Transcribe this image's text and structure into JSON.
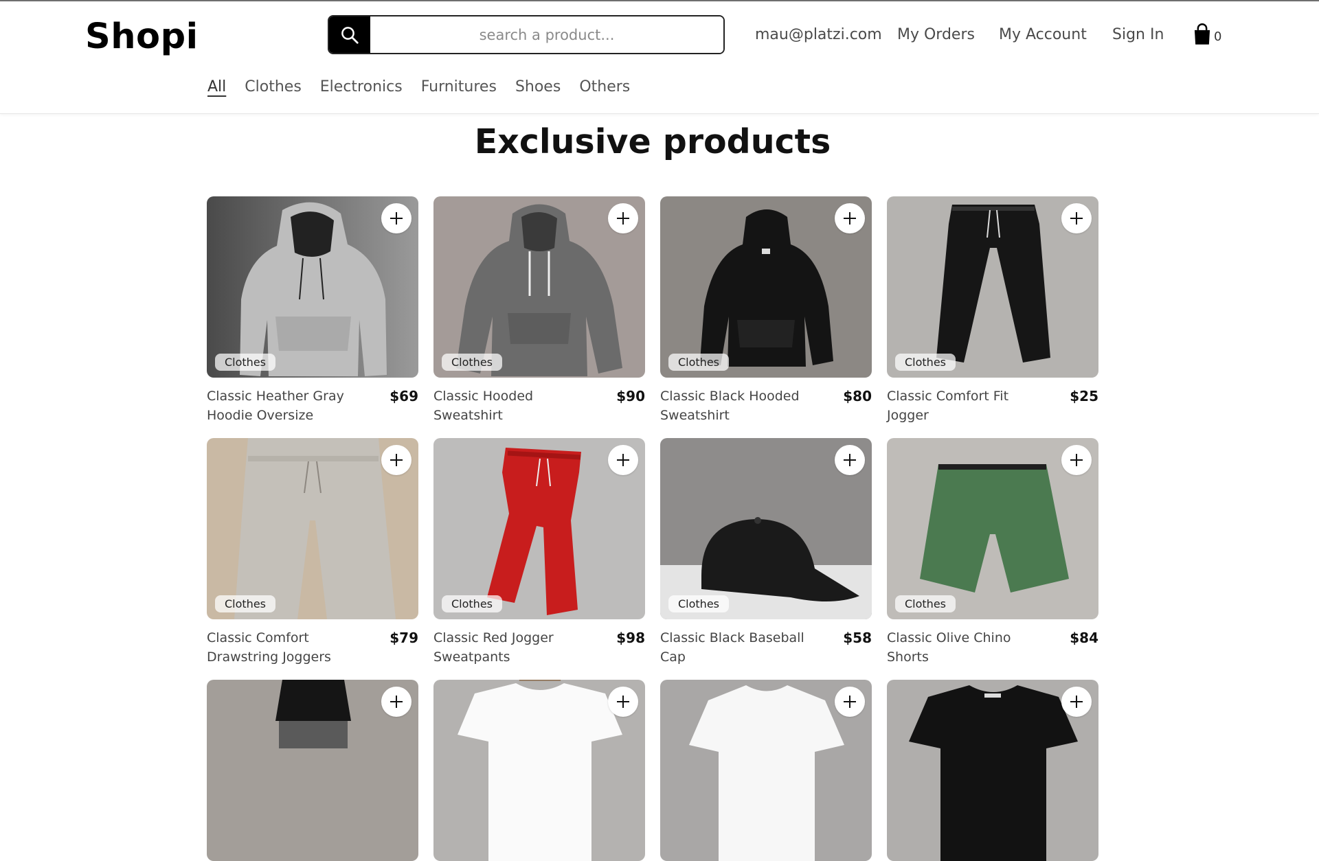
{
  "brand": {
    "name": "Shopi"
  },
  "search": {
    "placeholder": "search a product..."
  },
  "account": {
    "email": "mau@platzi.com",
    "orders_label": "My Orders",
    "account_label": "My Account",
    "signin_label": "Sign In",
    "cart_count": "0"
  },
  "categories": [
    "All",
    "Clothes",
    "Electronics",
    "Furnitures",
    "Shoes",
    "Others"
  ],
  "active_category": "All",
  "page": {
    "heading": "Exclusive products"
  },
  "products": [
    {
      "name": "Classic Heather Gray Hoodie Oversize",
      "price": "$69",
      "category": "Clothes"
    },
    {
      "name": "Classic Hooded Sweatshirt",
      "price": "$90",
      "category": "Clothes"
    },
    {
      "name": "Classic Black Hooded Sweatshirt",
      "price": "$80",
      "category": "Clothes"
    },
    {
      "name": "Classic Comfort Fit Jogger",
      "price": "$25",
      "category": "Clothes"
    },
    {
      "name": "Classic Comfort Drawstring Joggers",
      "price": "$79",
      "category": "Clothes"
    },
    {
      "name": "Classic Red Jogger Sweatpants",
      "price": "$98",
      "category": "Clothes"
    },
    {
      "name": "Classic Black Baseball Cap",
      "price": "$58",
      "category": "Clothes"
    },
    {
      "name": "Classic Olive Chino Shorts",
      "price": "$84",
      "category": "Clothes"
    }
  ],
  "colors": {
    "accent": "#000000",
    "text": "#444444"
  }
}
